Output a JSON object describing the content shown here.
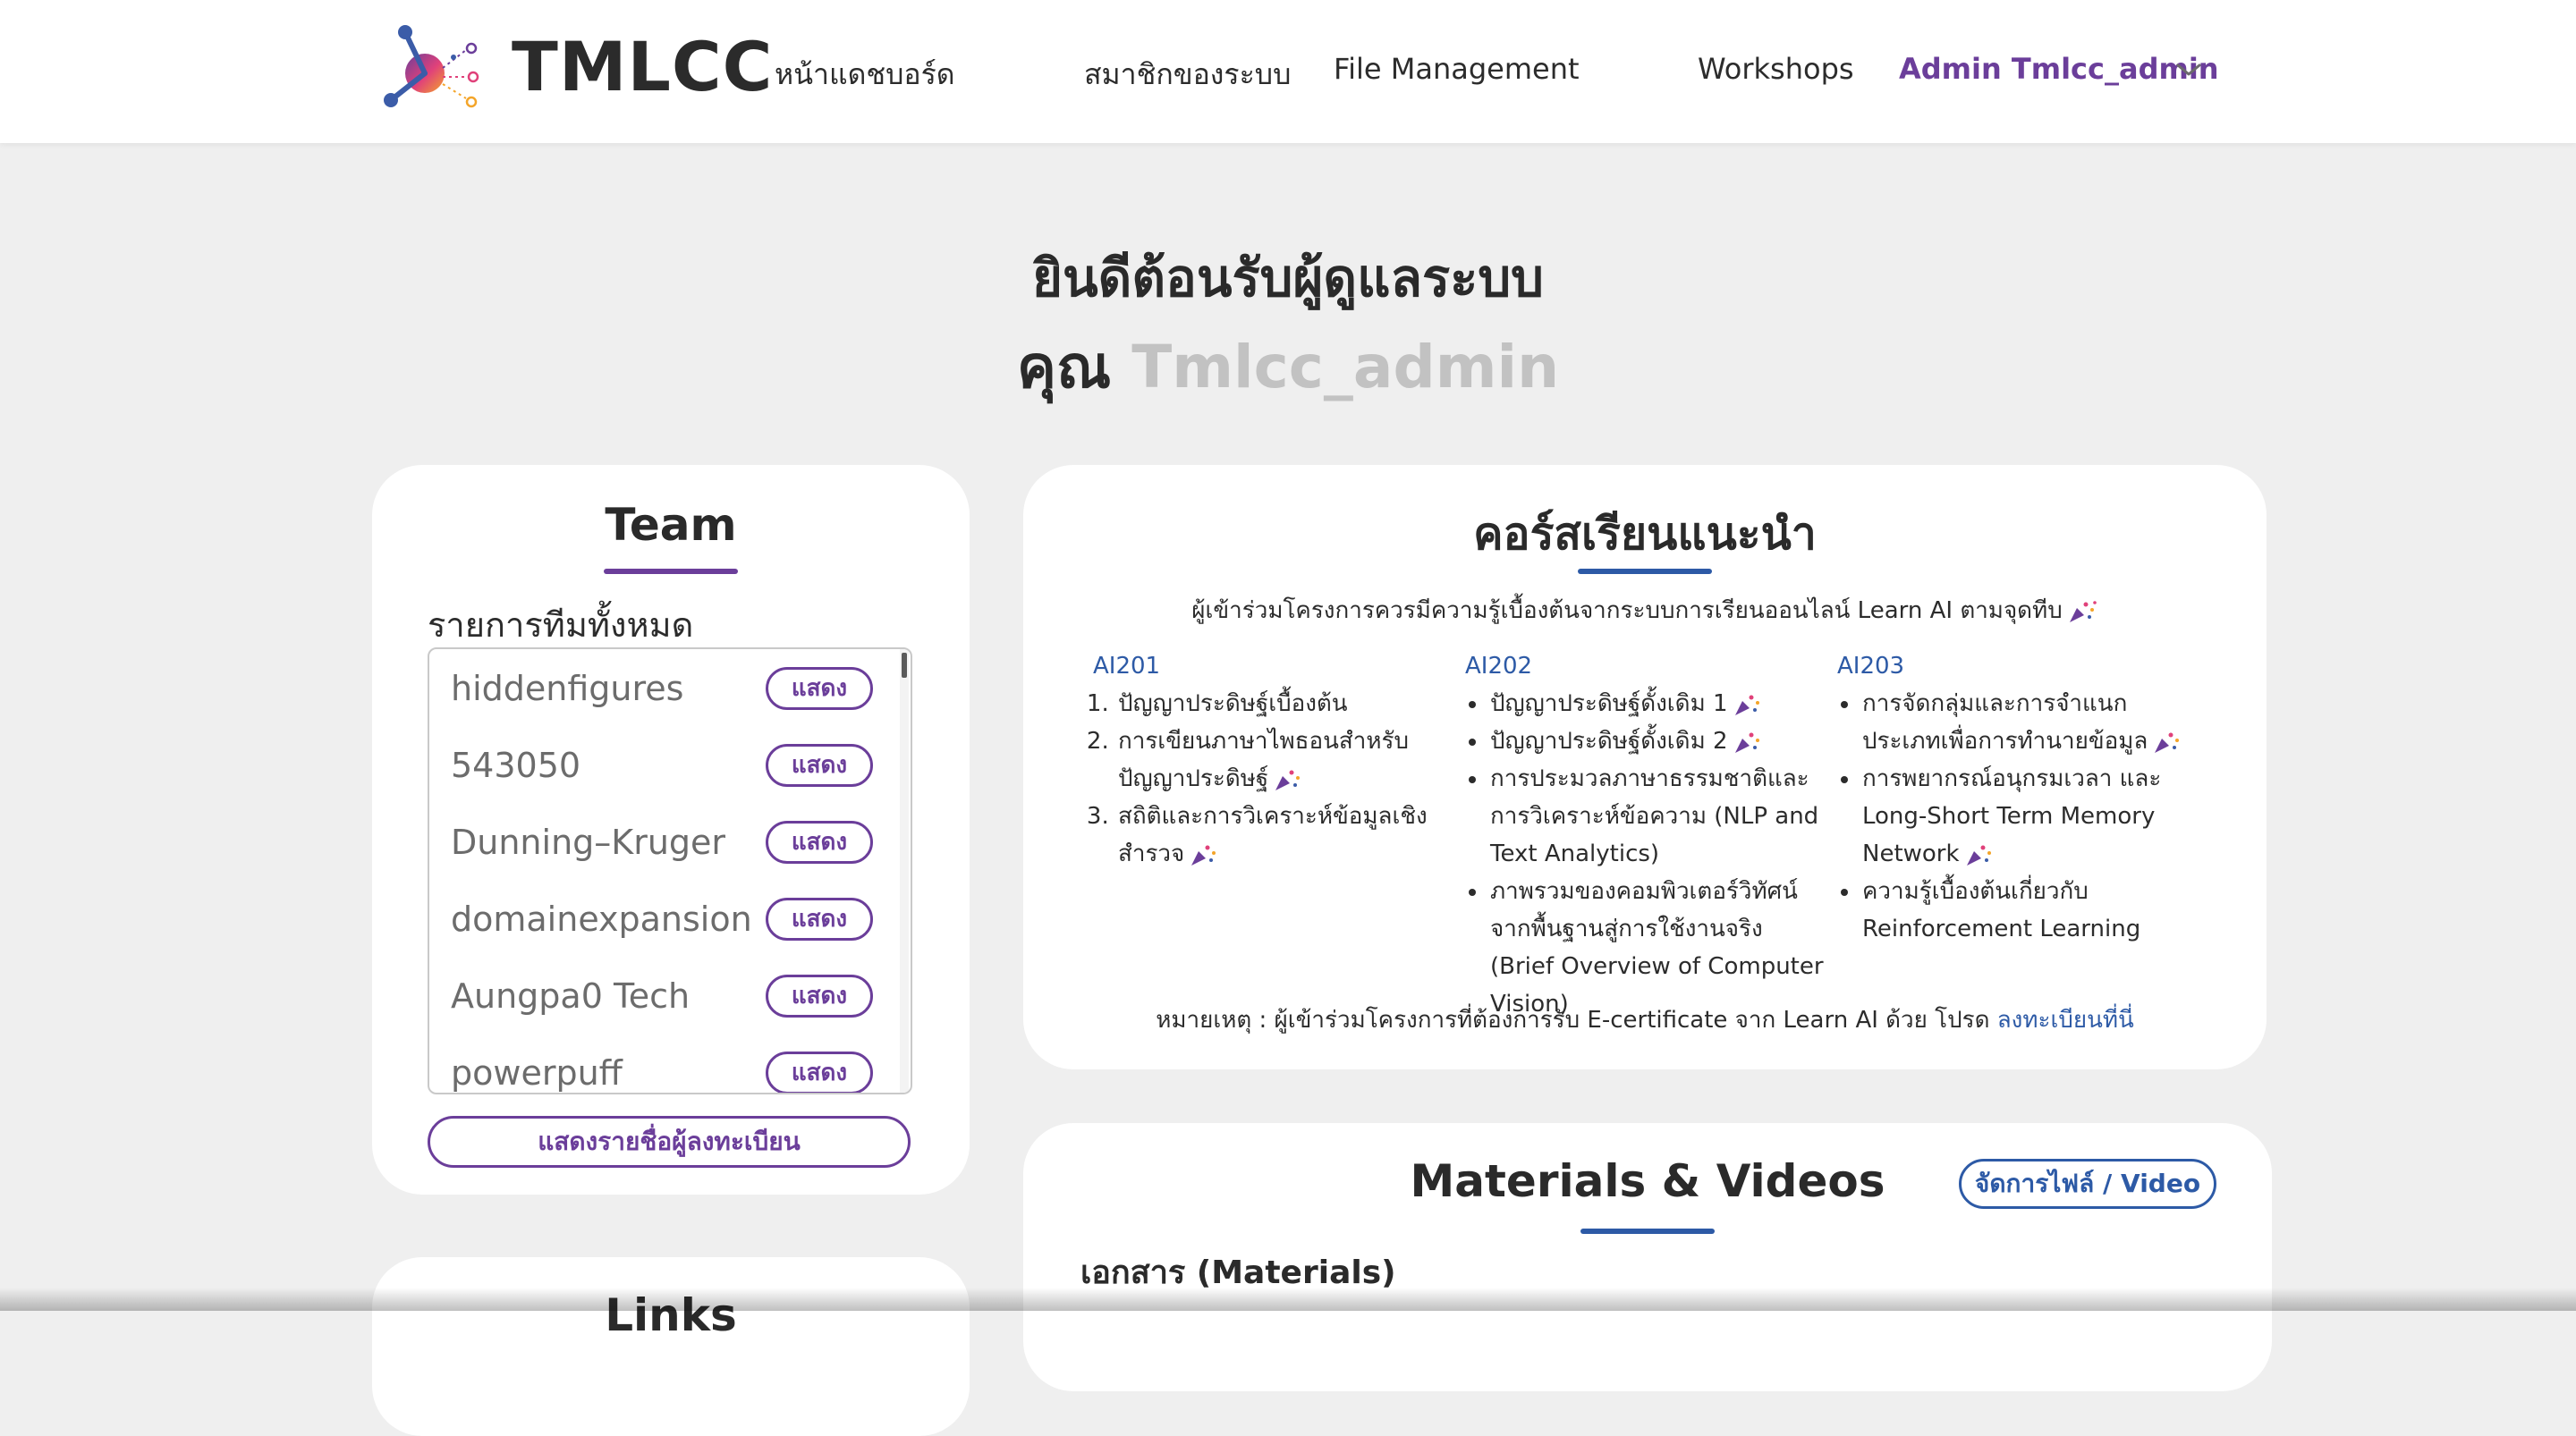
{
  "brand": {
    "name": "TMLCC"
  },
  "nav": {
    "items": [
      "หน้าแดชบอร์ด",
      "สมาชิกของระบบ",
      "File Management",
      "Workshops"
    ],
    "user": "Admin Tmlcc_admin"
  },
  "welcome": {
    "line1": "ยินดีต้อนรับผู้ดูแลระบบ",
    "prefix": "คุณ",
    "username": "Tmlcc_admin"
  },
  "team": {
    "title": "Team",
    "subtitle": "รายการทีมทั้งหมด",
    "show_label": "แสดง",
    "teams": [
      "hiddenfigures",
      "543050",
      "Dunning–Kruger",
      "domainexpansion",
      "Aungpa0 Tech",
      "powerpuff"
    ],
    "register_button": "แสดงรายชื่อผู้ลงทะเบียน"
  },
  "courses": {
    "title": "คอร์สเรียนแนะนำ",
    "intro": "ผู้เข้าร่วมโครงการควรมีความรู้เบื้องต้นจากระบบการเรียนออนไลน์ Learn AI ตามจุดทีบ",
    "columns": [
      {
        "code": "AI201",
        "items": [
          "ปัญญาประดิษฐ์เบื้องต้น",
          "การเขียนภาษาไพธอนสำหรับปัญญาประดิษฐ์",
          "สถิติและการวิเคราะห์ข้อมูลเชิงสำรวจ"
        ]
      },
      {
        "code": "AI202",
        "items": [
          "ปัญญาประดิษฐ์ดั้งเดิม 1",
          "ปัญญาประดิษฐ์ดั้งเดิม 2",
          "การประมวลภาษาธรรมชาติและการวิเคราะห์ข้อความ (NLP and Text Analytics)",
          "ภาพรวมของคอมพิวเตอร์วิทัศน์จากพื้นฐานสู่การใช้งานจริง (Brief Overview of Computer Vision)"
        ]
      },
      {
        "code": "AI203",
        "items": [
          "การจัดกลุ่มและการจำแนกประเภทเพื่อการทำนายข้อมูล",
          "การพยากรณ์อนุกรมเวลา และ Long-Short Term Memory Network",
          "ความรู้เบื้องต้นเกี่ยวกับ Reinforcement Learning"
        ]
      }
    ],
    "note": "หมายเหตุ : ผู้เข้าร่วมโครงการที่ต้องการรับ E-certificate จาก Learn AI ด้วย โปรด",
    "note_link": "ลงทะเบียนที่นี่"
  },
  "materials": {
    "title": "Materials & Videos",
    "manage_button": "จัดการไฟล์ / Video",
    "section": "เอกสาร (Materials)"
  },
  "links": {
    "title": "Links"
  },
  "colors": {
    "purple": "#6b3e9a",
    "blue": "#2d5aa6",
    "background": "#efefef"
  }
}
